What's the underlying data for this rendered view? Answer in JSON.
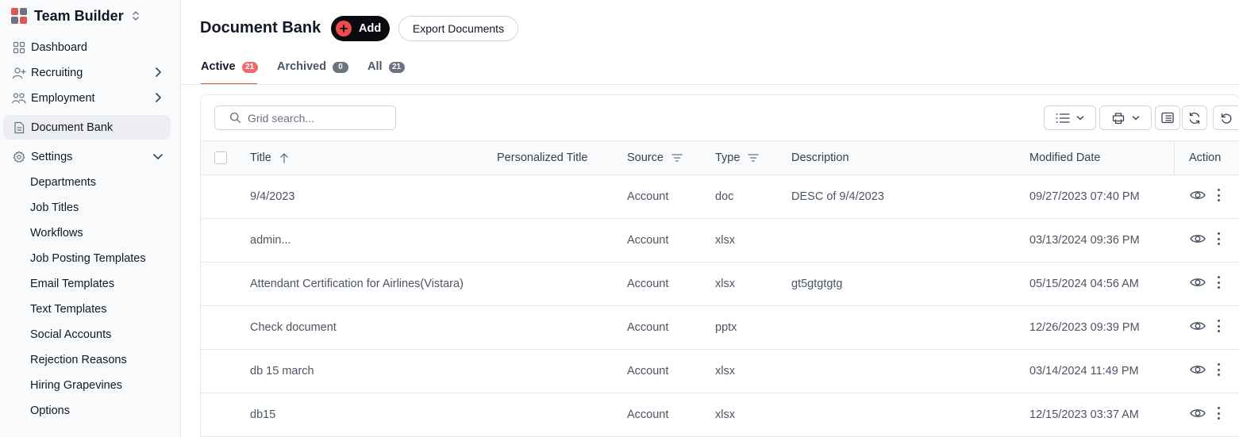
{
  "app": {
    "name": "Team Builder",
    "brand_colors": [
      "#e25555",
      "#6b7280",
      "#6b7280",
      "#e25555"
    ]
  },
  "sidebar": {
    "nav": [
      {
        "label": "Dashboard",
        "icon": "dashboard-icon",
        "chevron": false
      },
      {
        "label": "Recruiting",
        "icon": "user-plus-icon",
        "chevron": "right"
      },
      {
        "label": "Employment",
        "icon": "users-icon",
        "chevron": "right"
      },
      {
        "label": "Document Bank",
        "icon": "document-icon",
        "chevron": false,
        "active": true
      },
      {
        "label": "Settings",
        "icon": "gear-icon",
        "chevron": "down"
      }
    ],
    "settings_items": [
      "Departments",
      "Job Titles",
      "Workflows",
      "Job Posting Templates",
      "Email Templates",
      "Text Templates",
      "Social Accounts",
      "Rejection Reasons",
      "Hiring Grapevines",
      "Options"
    ]
  },
  "header": {
    "title": "Document Bank",
    "add_label": "Add",
    "export_label": "Export Documents"
  },
  "tabs": [
    {
      "label": "Active",
      "count": "21",
      "active": true,
      "badge_color": "#ef6b6b"
    },
    {
      "label": "Archived",
      "count": "0",
      "active": false,
      "badge_color": "#6b7280"
    },
    {
      "label": "All",
      "count": "21",
      "active": false,
      "badge_color": "#6b7280"
    }
  ],
  "grid": {
    "search_placeholder": "Grid search...",
    "toolbar_icons": [
      "list-view-icon",
      "export-icon",
      "columns-icon",
      "refresh-icon",
      "reset-icon"
    ],
    "columns": {
      "title": "Title",
      "personalized_title": "Personalized Title",
      "source": "Source",
      "type": "Type",
      "description": "Description",
      "modified_date": "Modified Date",
      "action": "Action"
    },
    "rows": [
      {
        "title": "9/4/2023",
        "personalized_title": "",
        "source": "Account",
        "type": "doc",
        "description": "DESC of 9/4/2023",
        "modified_date": "09/27/2023 07:40 PM"
      },
      {
        "title": "admin...",
        "personalized_title": "",
        "source": "Account",
        "type": "xlsx",
        "description": "",
        "modified_date": "03/13/2024 09:36 PM"
      },
      {
        "title": "Attendant Certification for Airlines(Vistara)",
        "personalized_title": "",
        "source": "Account",
        "type": "xlsx",
        "description": "gt5gtgtgtg",
        "modified_date": "05/15/2024 04:56 AM"
      },
      {
        "title": "Check document",
        "personalized_title": "",
        "source": "Account",
        "type": "pptx",
        "description": "",
        "modified_date": "12/26/2023 09:39 PM"
      },
      {
        "title": "db 15 march",
        "personalized_title": "",
        "source": "Account",
        "type": "xlsx",
        "description": "",
        "modified_date": "03/14/2024 11:49 PM"
      },
      {
        "title": "db15",
        "personalized_title": "",
        "source": "Account",
        "type": "xlsx",
        "description": "",
        "modified_date": "12/15/2023 03:37 AM"
      }
    ]
  }
}
